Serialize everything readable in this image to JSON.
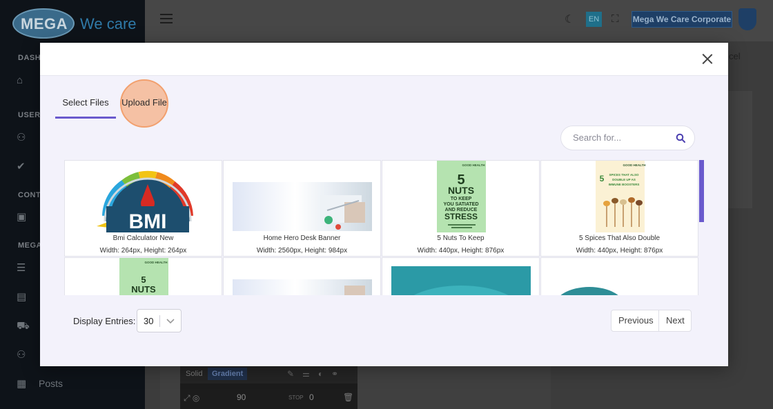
{
  "app": {
    "logo_mega": "MEGA",
    "logo_wecare": "We care",
    "sidebar_sections": [
      "DASH",
      "USER",
      "CONT",
      "MEGA"
    ],
    "sidebar_last_item": "Posts",
    "lang": "EN",
    "org_button": "Mega We Care Corporate",
    "bg_cancel": "cel",
    "editor": {
      "solid": "Solid",
      "gradient": "Gradient",
      "angle": "90",
      "stop_label": "STOP",
      "stop_value": "0"
    }
  },
  "modal": {
    "tabs": [
      {
        "label": "Select Files",
        "active": true
      },
      {
        "label": "Upload File",
        "active": false
      }
    ],
    "search": {
      "placeholder": "Search for..."
    },
    "files": [
      {
        "name": "Bmi Calculator New",
        "dims": "Width: 264px, Height: 264px"
      },
      {
        "name": "Home Hero Desk Banner",
        "dims": "Width: 2560px, Height: 984px"
      },
      {
        "name": "5 Nuts To Keep",
        "dims": "Width: 440px, Height: 876px"
      },
      {
        "name": "5 Spices That Also Double",
        "dims": "Width: 440px, Height: 876px"
      }
    ],
    "thumb_text": {
      "bmi": "BMI",
      "good_health": "GOOD HEALTH",
      "nuts_big": "5",
      "nuts_word": "NUTS",
      "nuts_line1": "TO KEEP",
      "nuts_line2": "YOU SATIATED",
      "nuts_line3": "AND REDUCE",
      "nuts_line4": "STRESS",
      "spices_num": "5",
      "spices_line1": "SPICES THAT ALSO",
      "spices_line2": "DOUBLE UP AS",
      "spices_line3": "IMMUNE BOOSTERS"
    },
    "display_entries_label": "Display Entries:",
    "display_entries_value": "30",
    "pagination": {
      "previous": "Previous",
      "next": "Next"
    },
    "colors": {
      "accent": "#6a5acd",
      "highlight": "#f6b087"
    }
  }
}
